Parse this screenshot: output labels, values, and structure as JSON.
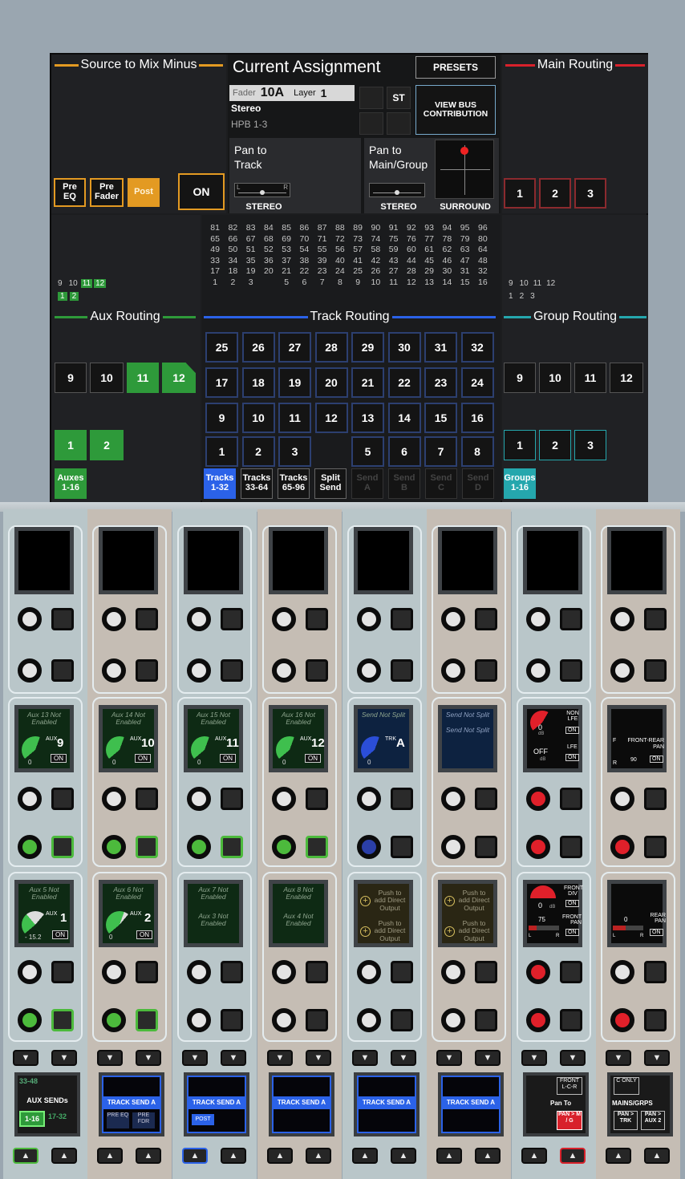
{
  "header": {
    "source_title": "Source to Mix Minus",
    "current_title": "Current Assignment",
    "presets": "PRESETS",
    "main_title": "Main Routing",
    "fader_label": "Fader",
    "fader_value": "10A",
    "layer_label": "Layer",
    "layer_value": "1",
    "st": "ST",
    "view_bus": "VIEW BUS CONTRIBUTION",
    "stereo": "Stereo",
    "hpb": "HPB 1-3",
    "pan_track": "Pan to Track",
    "pan_main": "Pan to Main/Group",
    "stereo1": "STEREO",
    "stereo2": "STEREO",
    "surround": "SURROUND",
    "l": "L",
    "r": "R",
    "pre_eq": "Pre EQ",
    "pre_fader": "Pre Fader",
    "post": "Post",
    "on": "ON",
    "main_btns": [
      "1",
      "2",
      "3"
    ]
  },
  "aux": {
    "title": "Aux Routing",
    "mini_top": [
      "9",
      "10",
      "11",
      "12"
    ],
    "mini_bot": [
      "1",
      "2"
    ],
    "row1": [
      "9",
      "10",
      "11",
      "12"
    ],
    "row2": [
      "1",
      "2"
    ],
    "tab": "Auxes 1-16"
  },
  "track": {
    "title": "Track Routing",
    "grid": [
      "81",
      "82",
      "83",
      "84",
      "85",
      "86",
      "87",
      "88",
      "89",
      "90",
      "91",
      "92",
      "93",
      "94",
      "95",
      "96",
      "65",
      "66",
      "67",
      "68",
      "69",
      "70",
      "71",
      "72",
      "73",
      "74",
      "75",
      "76",
      "77",
      "78",
      "79",
      "80",
      "49",
      "50",
      "51",
      "52",
      "53",
      "54",
      "55",
      "56",
      "57",
      "58",
      "59",
      "60",
      "61",
      "62",
      "63",
      "64",
      "33",
      "34",
      "35",
      "36",
      "37",
      "38",
      "39",
      "40",
      "41",
      "42",
      "43",
      "44",
      "45",
      "46",
      "47",
      "48",
      "17",
      "18",
      "19",
      "20",
      "21",
      "22",
      "23",
      "24",
      "25",
      "26",
      "27",
      "28",
      "29",
      "30",
      "31",
      "32",
      "1",
      "2",
      "3",
      "",
      "5",
      "6",
      "7",
      "8",
      "9",
      "10",
      "11",
      "12",
      "13",
      "14",
      "15",
      "16"
    ],
    "rows": [
      [
        "25",
        "26",
        "27",
        "28",
        "29",
        "30",
        "31",
        "32"
      ],
      [
        "17",
        "18",
        "19",
        "20",
        "21",
        "22",
        "23",
        "24"
      ],
      [
        "9",
        "10",
        "11",
        "12",
        "13",
        "14",
        "15",
        "16"
      ],
      [
        "1",
        "2",
        "3",
        "",
        "5",
        "6",
        "7",
        "8"
      ]
    ],
    "tabs": [
      "Tracks 1-32",
      "Tracks 33-64",
      "Tracks 65-96",
      "Split Send",
      "Send A",
      "Send B",
      "Send C",
      "Send D"
    ]
  },
  "group": {
    "title": "Group Routing",
    "mini_top": [
      "9",
      "10",
      "11",
      "12"
    ],
    "mini_bot": [
      "1",
      "2",
      "3"
    ],
    "row1": [
      "9",
      "10",
      "11",
      "12"
    ],
    "row2": [
      "1",
      "2",
      "3"
    ],
    "tab": "Groups 1-16"
  },
  "strips": {
    "mid": [
      {
        "t1": "Aux 13 Not Enabled",
        "lbl": "AUX",
        "num": "9",
        "on": "ON",
        "zero": "0"
      },
      {
        "t1": "Aux 14 Not Enabled",
        "lbl": "AUX",
        "num": "10",
        "on": "ON",
        "zero": "0"
      },
      {
        "t1": "Aux 15 Not Enabled",
        "lbl": "AUX",
        "num": "11",
        "on": "ON",
        "zero": "0"
      },
      {
        "t1": "Aux 16 Not Enabled",
        "lbl": "AUX",
        "num": "12",
        "on": "ON",
        "zero": "0"
      },
      {
        "t1": "Send Not Split",
        "lbl": "TRK",
        "num": "A",
        "zero": "0"
      },
      {
        "t1": "Send Not Split",
        "t2": "Send Not Split"
      },
      {
        "a": "0",
        "b": "dB",
        "c": "NON LFE",
        "d": "ON",
        "e": "OFF",
        "f": "dB",
        "g": "LFE",
        "h": "ON"
      },
      {
        "a": "F",
        "b": "R",
        "c": "FRONT-REAR PAN",
        "d": "90",
        "e": "ON"
      }
    ],
    "low": [
      {
        "t1": "Aux 5 Not Enabled",
        "lbl": "AUX",
        "num": "1",
        "val": "- 15.2",
        "on": "ON"
      },
      {
        "t1": "Aux 6 Not Enabled",
        "lbl": "AUX",
        "num": "2",
        "val": "0",
        "on": "ON"
      },
      {
        "t1": "Aux 7 Not Enabled",
        "t2": "Aux 3 Not Enabled"
      },
      {
        "t1": "Aux 8 Not Enabled",
        "t2": "Aux 4 Not Enabled"
      },
      {
        "t1": "Push to add Direct Output",
        "t2": "Push to add Direct Output"
      },
      {
        "t1": "Push to add Direct Output",
        "t2": "Push to add Direct Output"
      },
      {
        "a": "0",
        "b": "dB",
        "c": "FRONT DIV",
        "d": "ON",
        "e": "75",
        "f": "FRONT PAN",
        "g": "L",
        "h": "R",
        "i": "ON"
      },
      {
        "a": "0",
        "b": "REAR PAN",
        "c": "L",
        "d": "R",
        "e": "ON"
      }
    ],
    "bottom": [
      {
        "a": "33-48",
        "b": "AUX SENDs",
        "c": "1-16",
        "d": "17-32"
      },
      {
        "a": "TRACK SEND A",
        "b": "PRE EQ",
        "c": "PRE FDR"
      },
      {
        "a": "TRACK SEND A",
        "b": "POST"
      },
      {
        "a": "TRACK SEND A"
      },
      {
        "a": "TRACK SEND A"
      },
      {
        "a": "TRACK SEND A"
      },
      {
        "a": "FRONT L-C-R",
        "b": "Pan To",
        "c": "PAN > M / G"
      },
      {
        "a": "C ONLY",
        "b": "MAINS/GRPS",
        "c": "PAN > TRK",
        "d": "PAN > AUX 2"
      }
    ]
  },
  "colors": {
    "accent_orange": "#e39a22",
    "green": "#2e9a3a",
    "blue": "#2b62e8",
    "teal": "#25a7ad",
    "red": "#d8212b"
  }
}
